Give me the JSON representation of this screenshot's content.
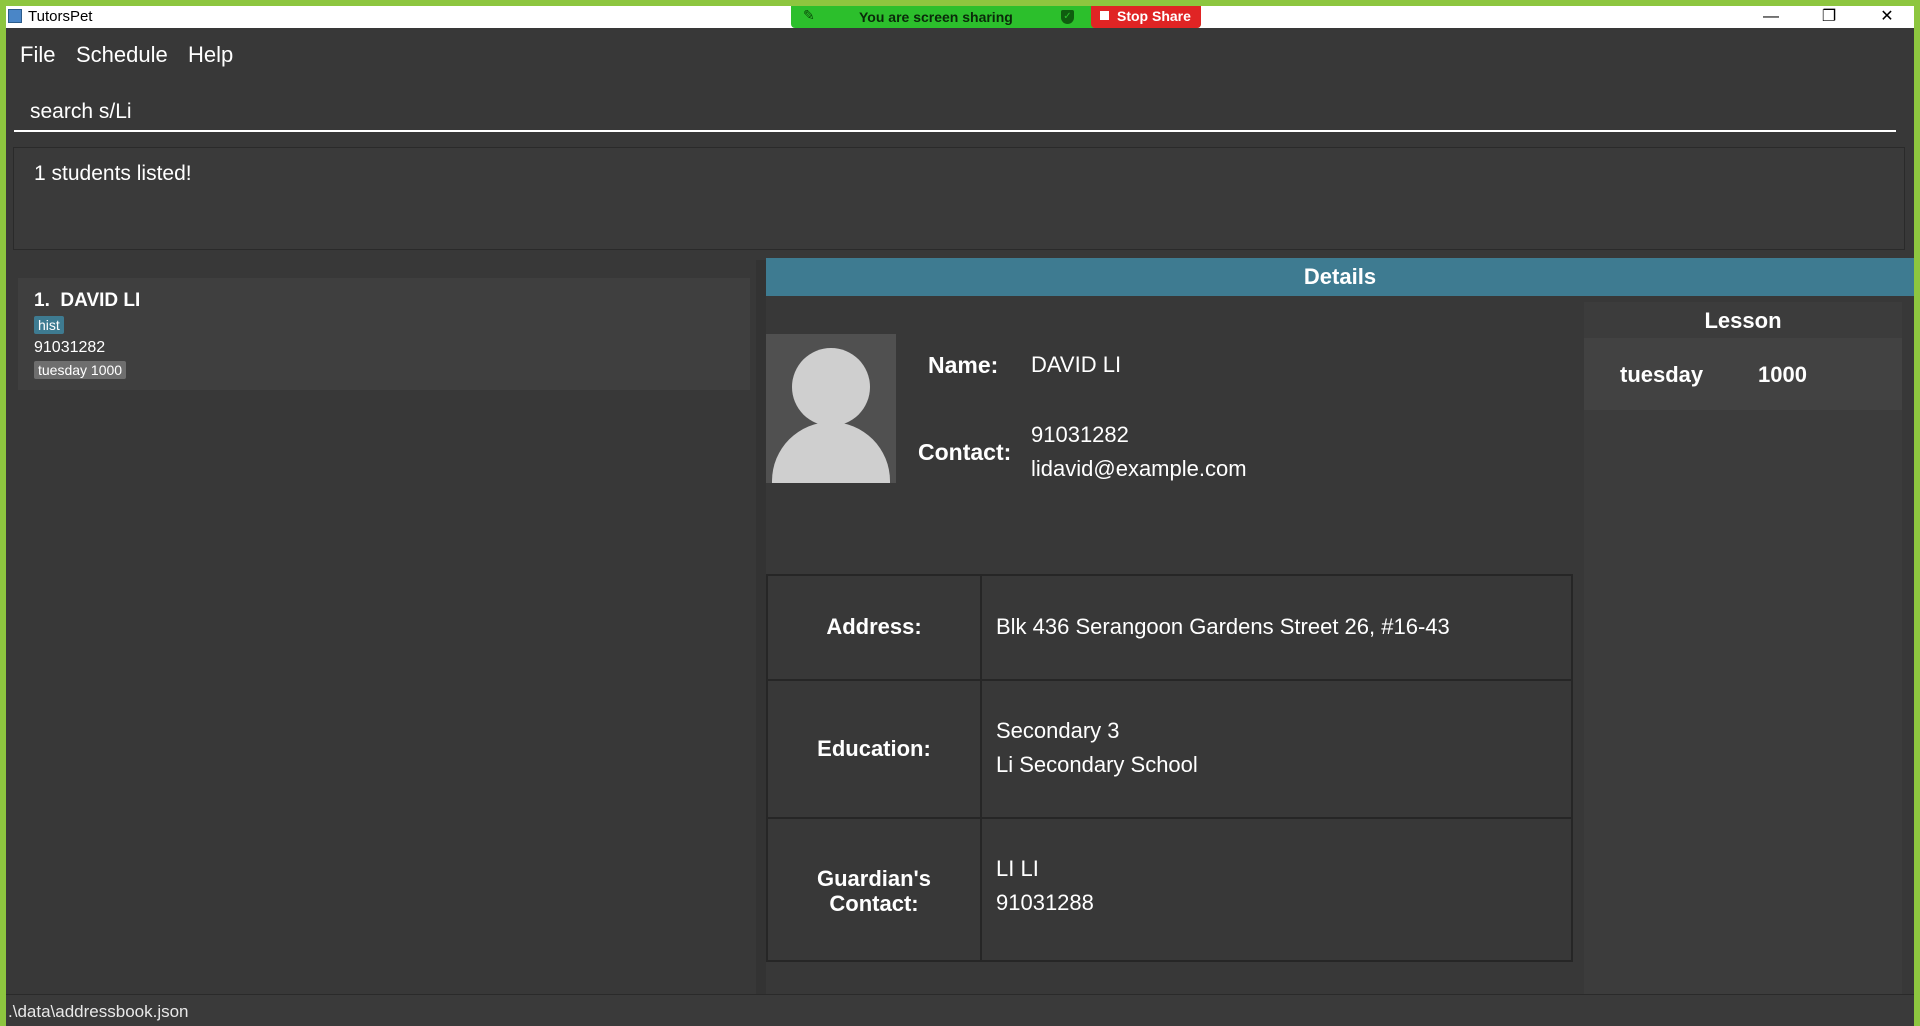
{
  "window": {
    "title": "TutorsPet",
    "controls": {
      "minimize": "—",
      "maximize": "❐",
      "close": "✕"
    }
  },
  "screen_share": {
    "message": "You are screen sharing",
    "stop_label": "Stop Share"
  },
  "menu": {
    "items": [
      "File",
      "Schedule",
      "Help"
    ]
  },
  "command_box": {
    "value": "search s/Li"
  },
  "result_display": {
    "text": "1 students listed!"
  },
  "student_list": [
    {
      "index": "1.",
      "name": "DAVID LI",
      "subject_tag": "hist",
      "phone": "91031282",
      "lesson_tag": "tuesday 1000"
    }
  ],
  "details": {
    "header": "Details",
    "name_label": "Name:",
    "name": "DAVID LI",
    "contact_label": "Contact:",
    "phone": "91031282",
    "email": "lidavid@example.com",
    "address_label": "Address:",
    "address": "Blk 436 Serangoon Gardens Street 26, #16-43",
    "education_label": "Education:",
    "education_level": "Secondary 3",
    "school": "Li Secondary School",
    "guardian_label_line1": "Guardian's",
    "guardian_label_line2": "Contact:",
    "guardian_name": "LI LI",
    "guardian_phone": "91031288"
  },
  "lesson": {
    "title": "Lesson",
    "entries": [
      {
        "day": "tuesday",
        "time": "1000"
      }
    ]
  },
  "status_bar": {
    "path": ".\\data\\addressbook.json"
  },
  "colors": {
    "background": "#383838",
    "accent": "#3e7b91",
    "share_green": "#2cbf2c",
    "stop_red": "#e02424",
    "outer_border": "#8dc63f"
  }
}
